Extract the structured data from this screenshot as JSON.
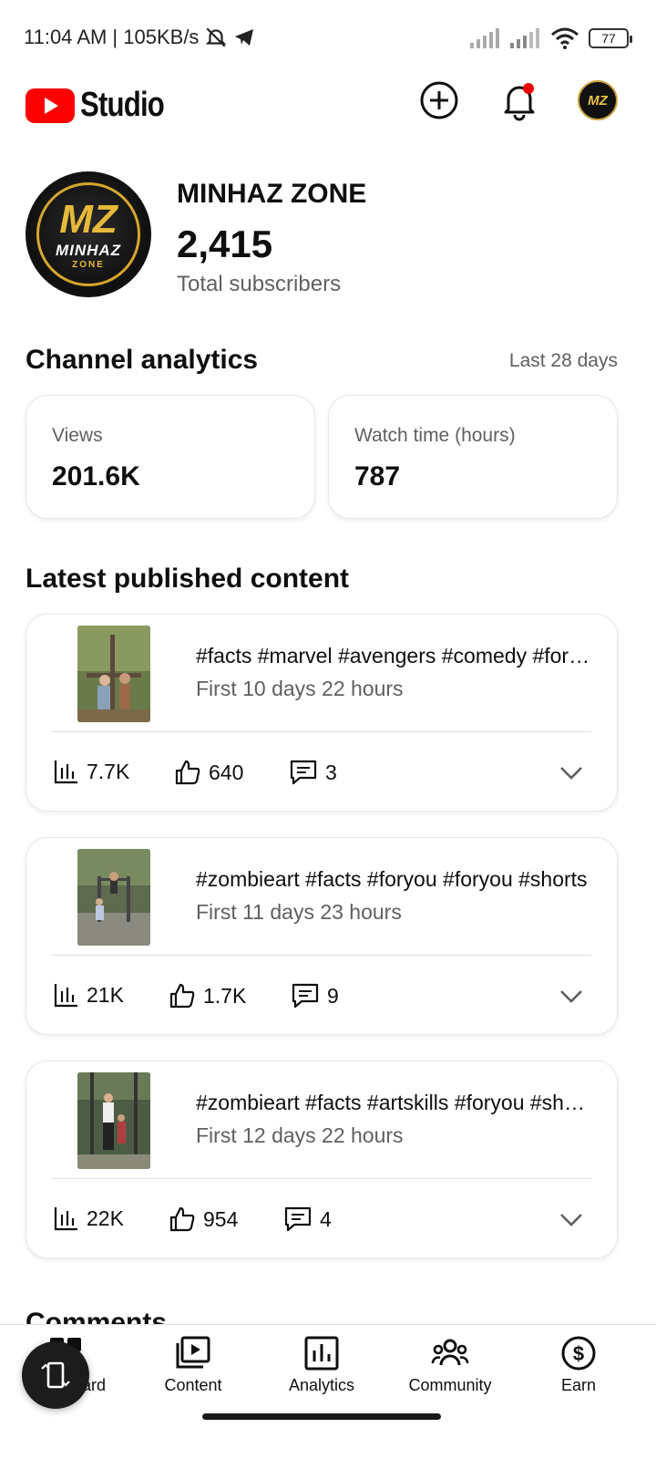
{
  "status_bar": {
    "time_speed": "11:04 AM | 105KB/s",
    "battery": "77"
  },
  "app_bar": {
    "logo_text": "Studio",
    "avatar_initials": "MZ"
  },
  "channel": {
    "name": "MINHAZ ZONE",
    "subscribers": "2,415",
    "subscribers_label": "Total subscribers",
    "avatar_mark": "MZ",
    "avatar_name": "MINHAZ",
    "avatar_tag": "ZONE"
  },
  "analytics": {
    "title": "Channel analytics",
    "period": "Last 28 days",
    "metrics": [
      {
        "label": "Views",
        "value": "201.6K"
      },
      {
        "label": "Watch time (hours)",
        "value": "787"
      }
    ]
  },
  "latest": {
    "title": "Latest published content",
    "items": [
      {
        "title": "#facts #marvel #avengers #comedy #foryou",
        "subtitle": "First 10 days 22 hours",
        "views": "7.7K",
        "likes": "640",
        "comments": "3"
      },
      {
        "title": "#zombieart #facts #foryou #foryou #shorts",
        "subtitle": "First 11 days 23 hours",
        "views": "21K",
        "likes": "1.7K",
        "comments": "9"
      },
      {
        "title": "#zombieart #facts #artskills #foryou #shorts",
        "subtitle": "First 12 days 22 hours",
        "views": "22K",
        "likes": "954",
        "comments": "4"
      }
    ]
  },
  "comments_heading": "Comments",
  "bottom_nav": [
    {
      "label": "Dashboard",
      "icon": "dashboard-icon"
    },
    {
      "label": "Content",
      "icon": "content-icon"
    },
    {
      "label": "Analytics",
      "icon": "analytics-icon"
    },
    {
      "label": "Community",
      "icon": "community-icon"
    },
    {
      "label": "Earn",
      "icon": "earn-icon"
    }
  ]
}
